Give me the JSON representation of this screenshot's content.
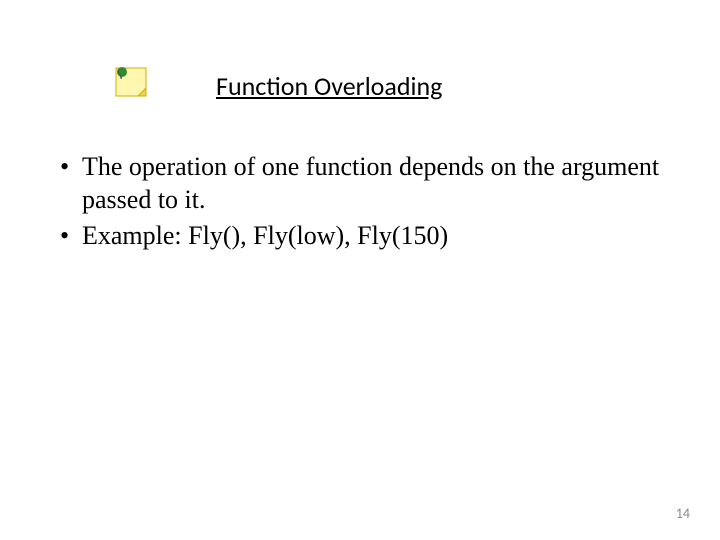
{
  "title": "Function Overloading",
  "bullets": [
    "The operation of one function depends on the argument passed to it.",
    " Example: Fly(), Fly(low), Fly(150)"
  ],
  "pageNumber": "14"
}
